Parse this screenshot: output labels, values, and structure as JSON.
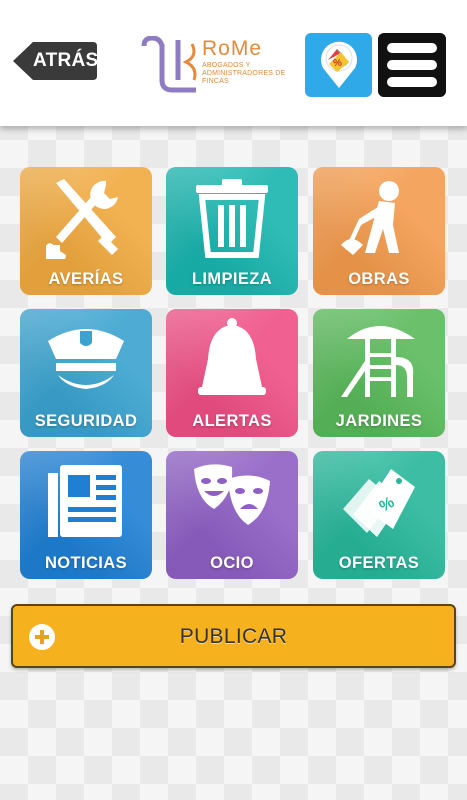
{
  "header": {
    "back_label": "ATRÁS",
    "logo_name": "RoMe",
    "logo_subtitle": "ABOGADOS Y ADMINISTRADORES DE FINCAS",
    "offers_icon": "offer-tag-icon",
    "menu_icon": "hamburger-menu-icon"
  },
  "categories": [
    {
      "label": "AVERÍAS",
      "icon": "tools-icon",
      "color": "#f0a93f"
    },
    {
      "label": "LIMPIEZA",
      "icon": "trash-icon",
      "color": "#19b4ae"
    },
    {
      "label": "OBRAS",
      "icon": "construction-worker-icon",
      "color": "#f39b4d"
    },
    {
      "label": "SEGURIDAD",
      "icon": "police-cap-icon",
      "color": "#3aa3cf"
    },
    {
      "label": "ALERTAS",
      "icon": "bell-icon",
      "color": "#ee4f85"
    },
    {
      "label": "JARDINES",
      "icon": "playground-icon",
      "color": "#59b95a"
    },
    {
      "label": "NOTICIAS",
      "icon": "newspaper-icon",
      "color": "#1f7fd3"
    },
    {
      "label": "OCIO",
      "icon": "theater-masks-icon",
      "color": "#8e5fc4"
    },
    {
      "label": "OFERTAS",
      "icon": "price-tags-icon",
      "color": "#27b79a"
    }
  ],
  "publish": {
    "label": "PUBLICAR",
    "icon": "plus-circle-icon",
    "color": "#f6b21e"
  }
}
